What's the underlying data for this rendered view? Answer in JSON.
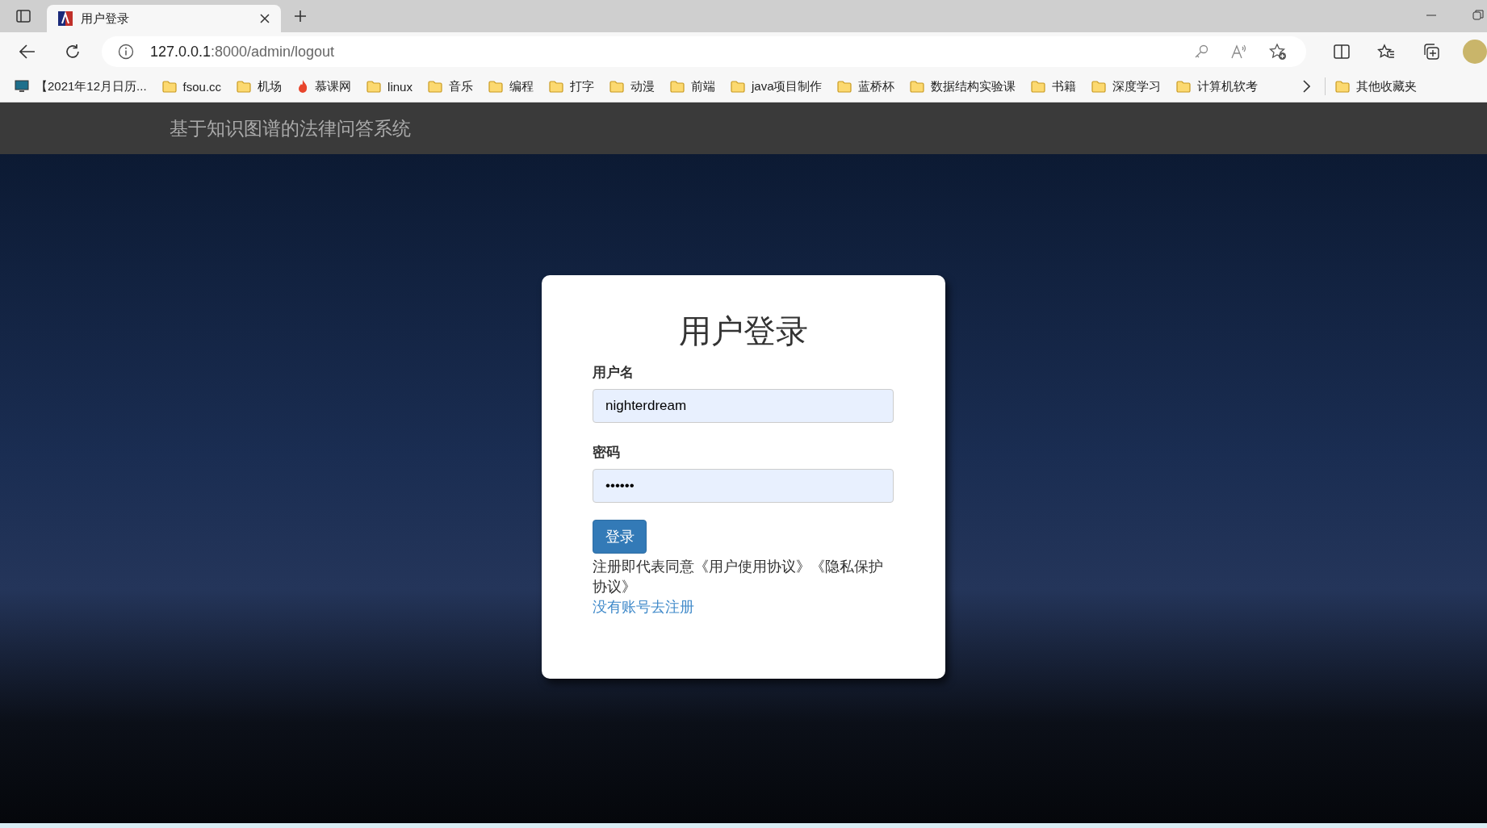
{
  "browser": {
    "tab": {
      "title": "用户登录",
      "selected": true
    },
    "address": {
      "host": "127.0.0.1",
      "path": ":8000/admin/logout"
    },
    "bookmarks": [
      {
        "kind": "monitor",
        "label": "【2021年12月日历..."
      },
      {
        "kind": "folder",
        "label": "fsou.cc"
      },
      {
        "kind": "folder",
        "label": "机场"
      },
      {
        "kind": "flame",
        "label": "慕课网"
      },
      {
        "kind": "folder",
        "label": "linux"
      },
      {
        "kind": "folder",
        "label": "音乐"
      },
      {
        "kind": "folder",
        "label": "编程"
      },
      {
        "kind": "folder",
        "label": "打字"
      },
      {
        "kind": "folder",
        "label": "动漫"
      },
      {
        "kind": "folder",
        "label": "前端"
      },
      {
        "kind": "folder",
        "label": "java项目制作"
      },
      {
        "kind": "folder",
        "label": "蓝桥杯"
      },
      {
        "kind": "folder",
        "label": "数据结构实验课"
      },
      {
        "kind": "folder",
        "label": "书籍"
      },
      {
        "kind": "folder",
        "label": "深度学习"
      },
      {
        "kind": "folder",
        "label": "计算机软考"
      }
    ],
    "other_bookmarks": "其他收藏夹"
  },
  "navbar": {
    "title": "基于知识图谱的法律问答系统"
  },
  "login": {
    "title": "用户登录",
    "fields": [
      {
        "label": "用户名",
        "value": "nighterdream"
      },
      {
        "label": "密码",
        "value": "••••••"
      }
    ],
    "button": "登录",
    "agreement": "注册即代表同意《用户使用协议》《隐私保护协议》",
    "register_link": "没有账号去注册"
  }
}
